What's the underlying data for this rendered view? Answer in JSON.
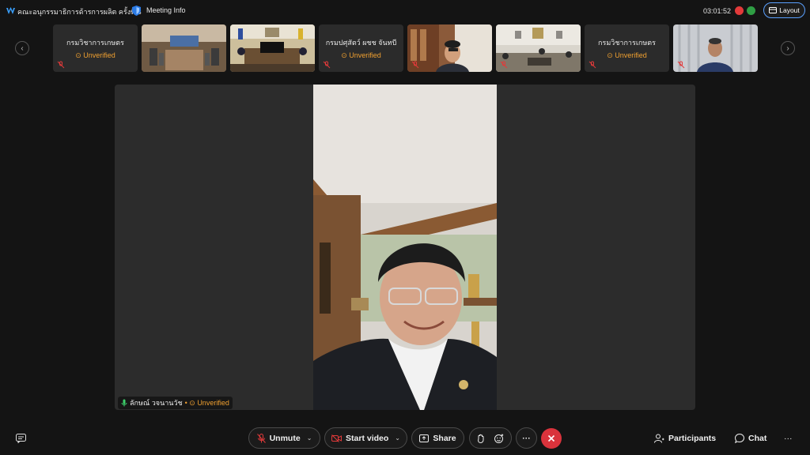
{
  "header": {
    "meeting_title": "คณะอนุกรรมาธิการด้ารการผลิต ครั้งที่ 3",
    "meeting_info": "Meeting Info",
    "timer": "03:01:52",
    "layout_label": "Layout"
  },
  "filmstrip": {
    "tiles": [
      {
        "type": "name",
        "name": "กรมวิชาการเกษตร",
        "status": "Unverified"
      },
      {
        "type": "video",
        "scene": "conference-room"
      },
      {
        "type": "video",
        "scene": "meeting-table"
      },
      {
        "type": "name",
        "name": "กรมปศุสัตว์ ผชช จันทบี",
        "status": "Unverified"
      },
      {
        "type": "video",
        "scene": "office-man"
      },
      {
        "type": "video",
        "scene": "seminar-room"
      },
      {
        "type": "name",
        "name": "กรมวิชาการเกษตร",
        "status": "Unverified"
      },
      {
        "type": "video",
        "scene": "man-curtain"
      }
    ]
  },
  "stage": {
    "speaker_name": "ลักษณ์ วจนานวัช",
    "speaker_status": "Unverified"
  },
  "controls": {
    "unmute": "Unmute",
    "start_video": "Start video",
    "share": "Share",
    "more": "···",
    "participants": "Participants",
    "chat": "Chat",
    "overflow": "···"
  },
  "colors": {
    "background": "#141414",
    "tile": "#2b2b2b",
    "unverified": "#f0a030",
    "end_call": "#d9333c",
    "accent": "#5aa0ff",
    "mic_off": "#e23a3a"
  },
  "icons": [
    "webex-logo-icon",
    "shield-icon",
    "record-icon",
    "network-icon",
    "layout-icon",
    "chevron-left-icon",
    "chevron-right-icon",
    "mic-off-icon",
    "warning-icon",
    "mic-icon",
    "video-off-icon",
    "share-icon",
    "raise-hand-icon",
    "reaction-icon",
    "end-call-icon",
    "participants-icon",
    "chat-icon",
    "captions-icon"
  ]
}
